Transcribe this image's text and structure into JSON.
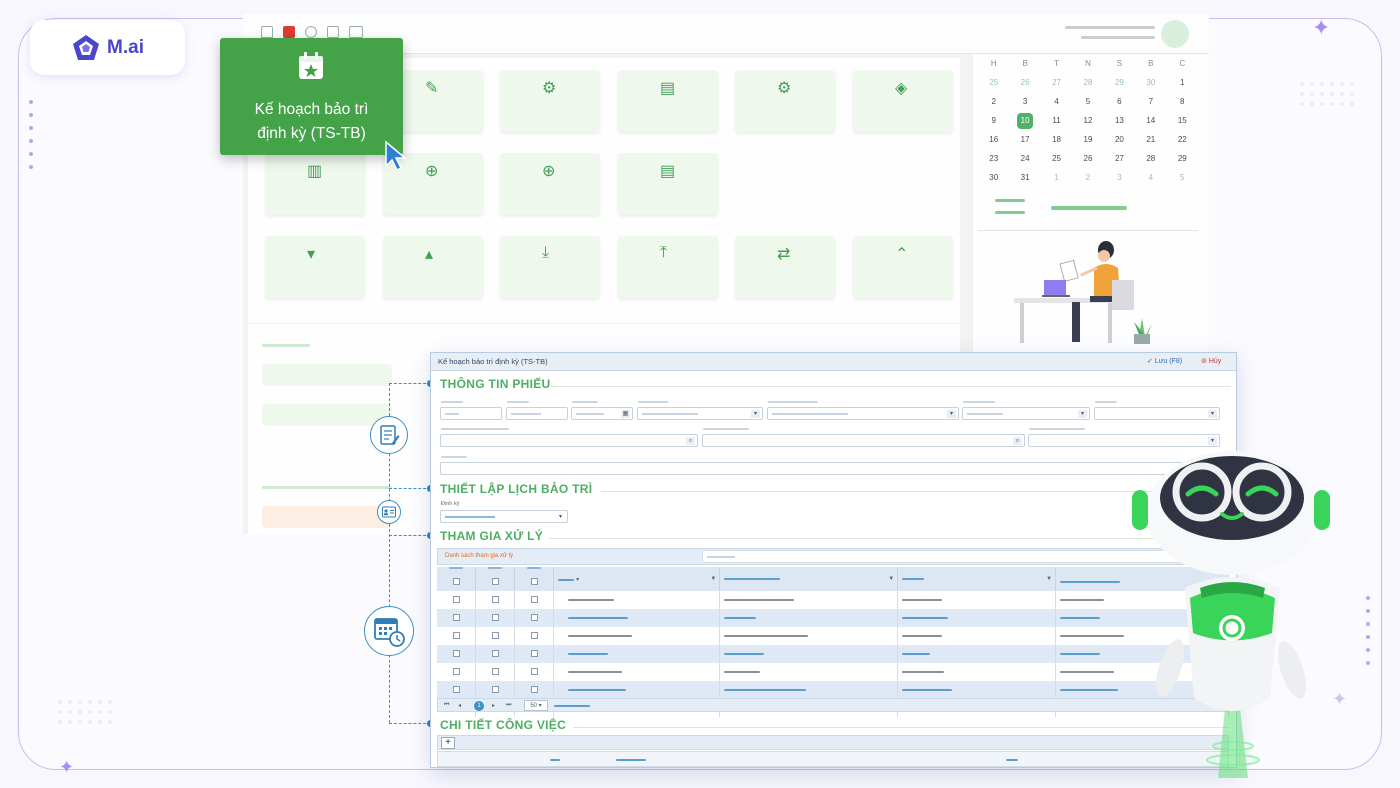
{
  "brand": {
    "name": "M.ai",
    "accent": "#4a45c9"
  },
  "tooltip_card": {
    "title_line1": "Kế hoạch bảo trì",
    "title_line2": "định kỳ (TS-TB)",
    "icon": "calendar-star-icon",
    "color": "#44a348"
  },
  "calendar": {
    "headers": [
      "H",
      "B",
      "T",
      "N",
      "S",
      "B",
      "C"
    ],
    "weeks": [
      [
        "25",
        "26",
        "27",
        "28",
        "29",
        "30",
        "1"
      ],
      [
        "2",
        "3",
        "4",
        "5",
        "6",
        "7",
        "8"
      ],
      [
        "9",
        "10",
        "11",
        "12",
        "13",
        "14",
        "15"
      ],
      [
        "16",
        "17",
        "18",
        "19",
        "20",
        "21",
        "22"
      ],
      [
        "23",
        "24",
        "25",
        "26",
        "27",
        "28",
        "29"
      ],
      [
        "30",
        "31",
        "1",
        "2",
        "3",
        "4",
        "5"
      ]
    ],
    "today": "10"
  },
  "form": {
    "window_title": "Kế hoạch bảo trì định kỳ (TS-TB)",
    "save_label": "Lưu (F8)",
    "cancel_label": "Hủy",
    "sections": {
      "info": "THÔNG TIN PHIẾU",
      "schedule": "THIẾT LẬP LỊCH BẢO TRÌ",
      "participants": "THAM GIA XỬ LÝ",
      "detail": "CHI TIẾT CÔNG VIỆC"
    },
    "schedule_field_label": "Định kỳ",
    "participants_list_label": "Danh sách tham gia xử lý",
    "page_size": "50"
  }
}
